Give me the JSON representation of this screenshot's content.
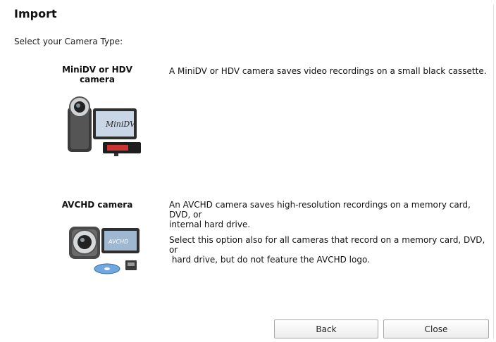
{
  "header": {
    "title": "Import",
    "subtitle": "Select your Camera Type:"
  },
  "options": [
    {
      "name_line1": "MiniDV or HDV",
      "name_line2": "camera",
      "description": "A MiniDV or HDV camera saves video recordings on a small black cassette.",
      "screen_text": "MiniDV",
      "icon": "minidv-camera-icon"
    },
    {
      "name": "AVCHD camera",
      "description_line1": "An AVCHD camera saves high-resolution recordings on a memory card, DVD, or",
      "description_line2": "internal hard drive.",
      "note_line1": "Select this option also for all cameras that record on a memory card, DVD, or",
      "note_line2": " hard drive, but do not feature the AVCHD logo.",
      "screen_text": "AVCHD",
      "icon": "avchd-camera-icon"
    }
  ],
  "buttons": {
    "back": "Back",
    "close": "Close"
  }
}
